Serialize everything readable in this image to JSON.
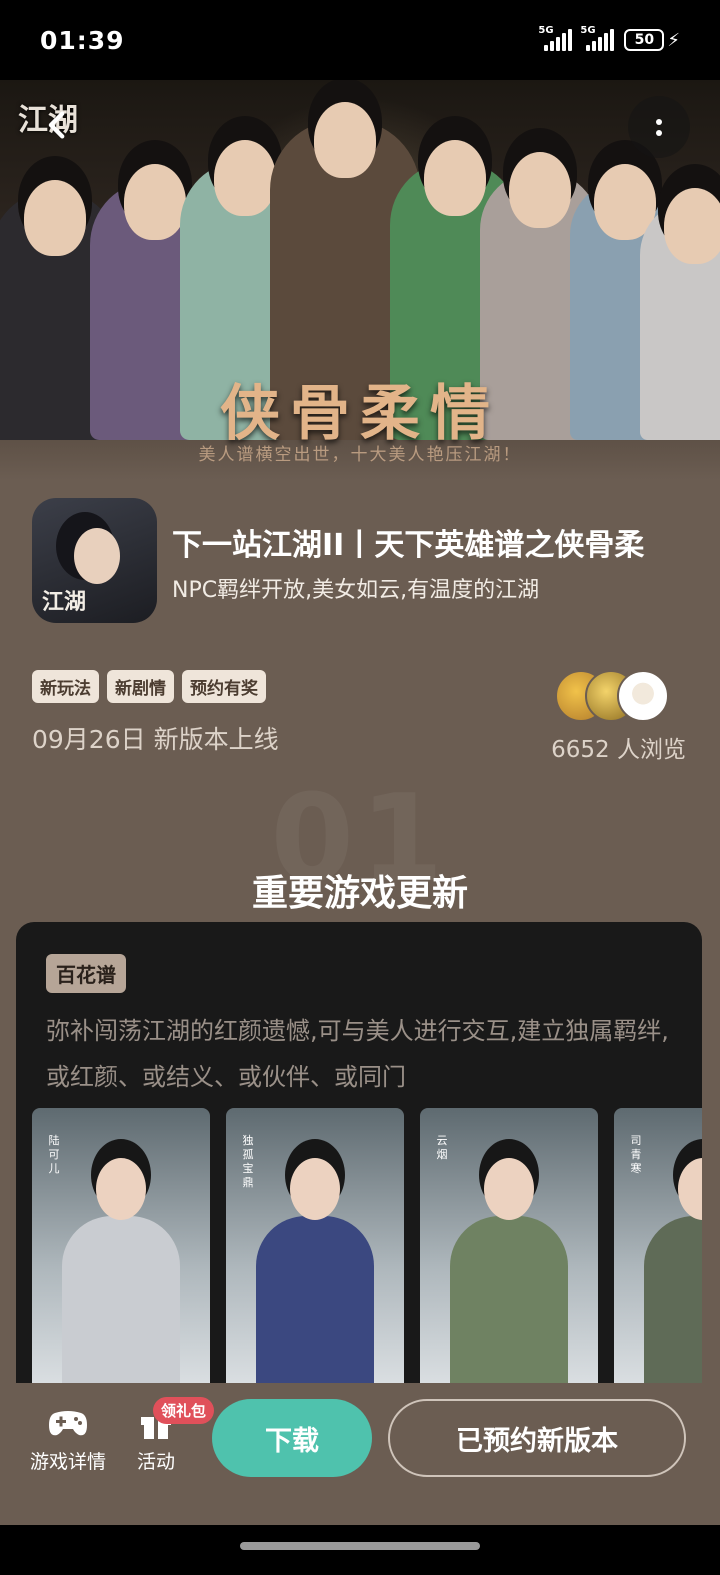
{
  "status_bar": {
    "time": "01:39",
    "network_1": "5G",
    "network_2": "5G",
    "battery": "50",
    "icons": [
      "signal-icon",
      "signal-icon",
      "battery-icon",
      "charging-icon"
    ]
  },
  "hero": {
    "logo_text": "江湖",
    "calligraphy_title": "侠骨柔情",
    "caption": "美人谱横空出世，十大美人艳压江湖！",
    "back_icon": "back-arrow-icon",
    "more_icon": "more-vertical-icon"
  },
  "game": {
    "icon_text": "江湖",
    "title": "下一站江湖II丨天下英雄谱之侠骨柔",
    "subtitle": "NPC羁绊开放,美女如云,有温度的江湖",
    "tags": [
      "新玩法",
      "新剧情",
      "预约有奖"
    ],
    "release_text": "09月26日 新版本上线",
    "views_text": "6652 人浏览"
  },
  "section": {
    "number": "01",
    "title": "重要游戏更新"
  },
  "feature_card": {
    "chip": "百花谱",
    "description": "弥补闯荡江湖的红颜遗憾,可与美人进行交互,建立独属羁绊,或红颜、或结义、或伙伴、或同门",
    "portraits": [
      {
        "name": "陆可儿",
        "color": "#c9ccd1"
      },
      {
        "name": "独孤宝鼎",
        "color": "#3b4880"
      },
      {
        "name": "云烟",
        "color": "#6f8262"
      },
      {
        "name": "司青寒",
        "color": "#5f6b57"
      }
    ]
  },
  "bottom_bar": {
    "game_details_label": "游戏详情",
    "activity_label": "活动",
    "gift_badge": "领礼包",
    "download_label": "下载",
    "reserved_label": "已预约新版本",
    "accent_color": "#4fc2ad",
    "badge_color": "#e0505a"
  }
}
